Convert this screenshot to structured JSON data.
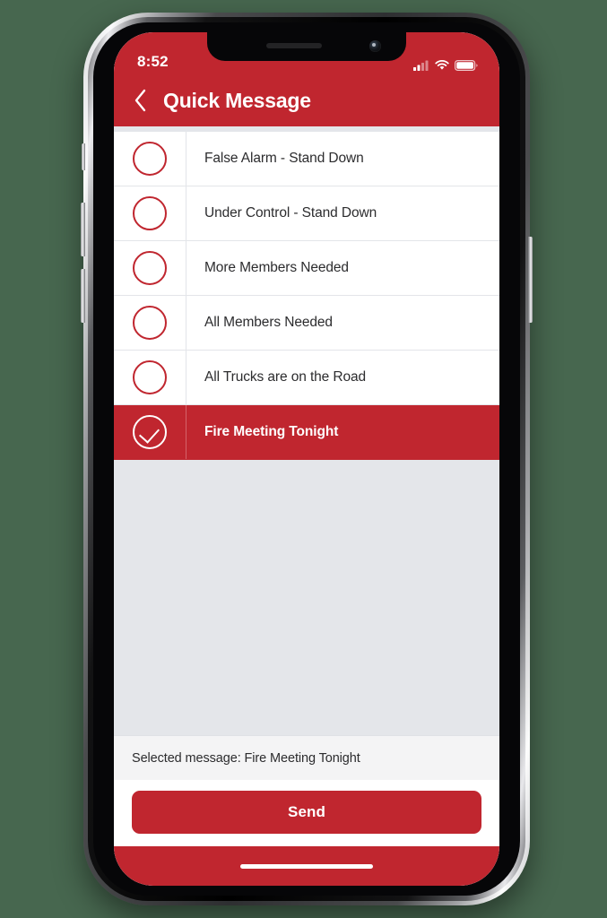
{
  "theme": {
    "brand_red": "#C0262F",
    "screen_gray": "#E4E6EA",
    "row_white": "#FFFFFF",
    "footer_gray": "#F4F4F5",
    "page_background": "#47674F"
  },
  "status_bar": {
    "time": "8:52",
    "icons": [
      "cellular-signal-icon",
      "wifi-icon",
      "battery-icon"
    ]
  },
  "nav_bar": {
    "back_icon": "chevron-left-icon",
    "title": "Quick Message"
  },
  "message_list": {
    "rows": [
      {
        "label": "False Alarm - Stand Down",
        "selected": false,
        "icon": "radio-unchecked-icon"
      },
      {
        "label": "Under Control - Stand Down",
        "selected": false,
        "icon": "radio-unchecked-icon"
      },
      {
        "label": "More Members Needed",
        "selected": false,
        "icon": "radio-unchecked-icon"
      },
      {
        "label": "All Members Needed",
        "selected": false,
        "icon": "radio-unchecked-icon"
      },
      {
        "label": "All Trucks are on the Road",
        "selected": false,
        "icon": "radio-unchecked-icon"
      },
      {
        "label": "Fire Meeting Tonight",
        "selected": true,
        "icon": "radio-checked-icon"
      }
    ]
  },
  "footer": {
    "selected_message_text": "Selected message: Fire Meeting Tonight",
    "send_label": "Send"
  },
  "hardware": {
    "buttons": [
      "mute-switch",
      "volume-up-button",
      "volume-down-button",
      "power-button"
    ],
    "notch": [
      "earpiece-speaker",
      "front-camera"
    ],
    "home_indicator": "home-indicator"
  }
}
